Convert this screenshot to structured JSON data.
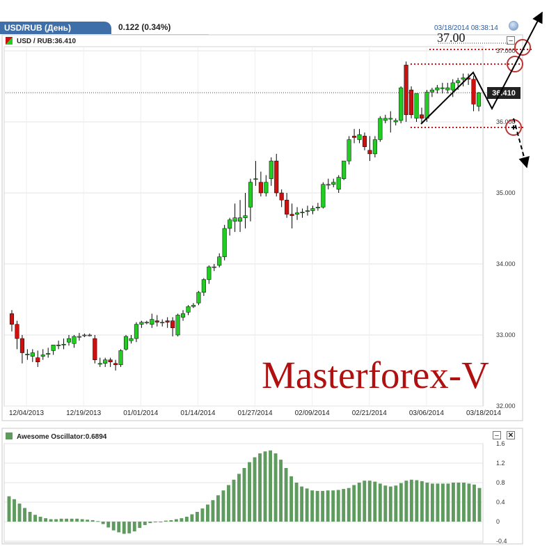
{
  "header": {
    "tab_label": "USD/RUB (День)",
    "change": "0.122 (0.34%)",
    "datetime": "03/18/2014 08:38:14"
  },
  "main_chart": {
    "symbol_label": "USD / RUB:36.410",
    "current_price_label": "36.410",
    "annotation_price": "37.00",
    "watermark_text": "Masterforex-V",
    "price_ticks": [
      "37.000",
      "36.000",
      "35.000",
      "34.000",
      "33.000",
      "32.000"
    ],
    "date_ticks": [
      "12/04/2013",
      "12/19/2013",
      "01/01/2014",
      "01/14/2014",
      "01/27/2014",
      "02/09/2014",
      "02/21/2014",
      "03/06/2014",
      "03/18/2014"
    ]
  },
  "oscillator": {
    "label": "Awesome Oscillator:0.6894",
    "ticks": [
      "1.6",
      "1.2",
      "0.8",
      "0.4",
      "0",
      "-0.4"
    ]
  },
  "colors": {
    "up_candle": "#22cc22",
    "down_candle": "#cc1111",
    "oscillator_bar": "#5f9a5f",
    "tab_bg": "#3f6fa8",
    "annotation_red": "#cc1111",
    "watermark": "#b01010"
  },
  "chart_data": [
    {
      "type": "candlestick",
      "title": "USD / RUB:36.410",
      "ylim": [
        32.0,
        37.0
      ],
      "yticks": [
        32.0,
        33.0,
        34.0,
        35.0,
        36.0,
        37.0
      ],
      "last_price": 36.41,
      "series": [
        {
          "name": "USD/RUB",
          "ohlc": [
            [
              33.3,
              33.35,
              33.05,
              33.15
            ],
            [
              33.15,
              33.2,
              32.8,
              32.95
            ],
            [
              32.95,
              33.0,
              32.6,
              32.75
            ],
            [
              32.73,
              32.8,
              32.65,
              32.73
            ],
            [
              32.7,
              32.8,
              32.62,
              32.75
            ],
            [
              32.68,
              32.78,
              32.55,
              32.62
            ],
            [
              32.7,
              32.8,
              32.65,
              32.72
            ],
            [
              32.74,
              32.82,
              32.68,
              32.74
            ],
            [
              32.78,
              32.86,
              32.72,
              32.86
            ],
            [
              32.86,
              32.92,
              32.8,
              32.86
            ],
            [
              32.86,
              32.95,
              32.8,
              32.87
            ],
            [
              32.9,
              33.0,
              32.85,
              32.95
            ],
            [
              32.88,
              33.0,
              32.82,
              32.98
            ],
            [
              32.98,
              33.03,
              32.92,
              32.98
            ],
            [
              33.0,
              33.02,
              32.97,
              33.0
            ],
            [
              33.0,
              33.02,
              32.98,
              33.0
            ],
            [
              32.95,
              33.0,
              32.6,
              32.65
            ],
            [
              32.6,
              32.68,
              32.55,
              32.6
            ],
            [
              32.6,
              32.68,
              32.55,
              32.65
            ],
            [
              32.65,
              32.68,
              32.55,
              32.62
            ],
            [
              32.6,
              32.65,
              32.5,
              32.58
            ],
            [
              32.58,
              32.8,
              32.55,
              32.78
            ],
            [
              32.8,
              33.0,
              32.78,
              32.98
            ],
            [
              32.92,
              33.0,
              32.88,
              32.95
            ],
            [
              32.95,
              33.18,
              32.9,
              33.15
            ],
            [
              33.15,
              33.2,
              33.1,
              33.18
            ],
            [
              33.18,
              33.2,
              33.15,
              33.18
            ],
            [
              33.15,
              33.3,
              33.1,
              33.22
            ],
            [
              33.2,
              33.28,
              33.12,
              33.18
            ],
            [
              33.18,
              33.22,
              33.12,
              33.18
            ],
            [
              33.2,
              33.25,
              33.1,
              33.18
            ],
            [
              33.2,
              33.25,
              32.98,
              33.1
            ],
            [
              33.0,
              33.3,
              32.98,
              33.28
            ],
            [
              33.25,
              33.35,
              33.2,
              33.3
            ],
            [
              33.32,
              33.42,
              33.28,
              33.4
            ],
            [
              33.4,
              33.45,
              33.38,
              33.42
            ],
            [
              33.45,
              33.62,
              33.42,
              33.6
            ],
            [
              33.6,
              33.8,
              33.55,
              33.78
            ],
            [
              33.78,
              33.98,
              33.72,
              33.96
            ],
            [
              33.95,
              34.0,
              33.9,
              33.96
            ],
            [
              33.98,
              34.15,
              33.95,
              34.1
            ],
            [
              34.1,
              34.55,
              34.05,
              34.5
            ],
            [
              34.5,
              34.65,
              34.4,
              34.62
            ],
            [
              34.6,
              34.85,
              34.45,
              34.65
            ],
            [
              34.6,
              34.9,
              34.45,
              34.65
            ],
            [
              34.65,
              35.0,
              34.5,
              34.68
            ],
            [
              34.8,
              35.2,
              34.6,
              35.15
            ],
            [
              35.2,
              35.45,
              35.1,
              35.2
            ],
            [
              35.15,
              35.3,
              34.95,
              35.0
            ],
            [
              35.0,
              35.25,
              34.95,
              35.15
            ],
            [
              35.2,
              35.5,
              35.1,
              35.45
            ],
            [
              35.45,
              35.55,
              34.95,
              35.0
            ],
            [
              35.0,
              35.05,
              34.8,
              34.9
            ],
            [
              34.9,
              35.0,
              34.65,
              34.7
            ],
            [
              34.7,
              34.85,
              34.5,
              34.68
            ],
            [
              34.7,
              34.8,
              34.62,
              34.72
            ],
            [
              34.72,
              34.78,
              34.65,
              34.73
            ],
            [
              34.75,
              34.82,
              34.68,
              34.75
            ],
            [
              34.75,
              34.82,
              34.7,
              34.78
            ],
            [
              34.8,
              34.86,
              34.75,
              34.8
            ],
            [
              34.8,
              35.15,
              34.78,
              35.12
            ],
            [
              35.12,
              35.2,
              35.05,
              35.12
            ],
            [
              35.12,
              35.2,
              35.08,
              35.15
            ],
            [
              35.05,
              35.25,
              35.0,
              35.22
            ],
            [
              35.2,
              35.45,
              35.18,
              35.45
            ],
            [
              35.45,
              35.8,
              35.4,
              35.75
            ],
            [
              35.8,
              35.9,
              35.7,
              35.78
            ],
            [
              35.75,
              35.9,
              35.7,
              35.82
            ],
            [
              35.8,
              35.85,
              35.6,
              35.65
            ],
            [
              35.6,
              35.8,
              35.45,
              35.55
            ],
            [
              35.55,
              35.8,
              35.5,
              35.75
            ],
            [
              35.75,
              36.08,
              35.72,
              36.05
            ],
            [
              36.02,
              36.1,
              35.98,
              36.05
            ],
            [
              36.05,
              36.15,
              35.85,
              36.05
            ],
            [
              36.0,
              36.05,
              35.95,
              36.02
            ],
            [
              36.02,
              36.5,
              35.98,
              36.48
            ],
            [
              36.8,
              36.85,
              36.0,
              36.1
            ],
            [
              36.45,
              36.5,
              36.05,
              36.1
            ],
            [
              36.05,
              36.4,
              36.0,
              36.4
            ],
            [
              36.1,
              36.2,
              35.98,
              36.05
            ],
            [
              36.05,
              36.45,
              36.0,
              36.42
            ],
            [
              36.42,
              36.48,
              36.35,
              36.45
            ],
            [
              36.45,
              36.52,
              36.4,
              36.48
            ],
            [
              36.48,
              36.55,
              36.4,
              36.48
            ],
            [
              36.45,
              36.55,
              36.4,
              36.48
            ],
            [
              36.45,
              36.6,
              36.35,
              36.55
            ],
            [
              36.55,
              36.62,
              36.45,
              36.58
            ],
            [
              36.6,
              36.68,
              36.5,
              36.62
            ],
            [
              36.62,
              36.68,
              36.52,
              36.6
            ],
            [
              36.6,
              36.65,
              36.15,
              36.25
            ],
            [
              36.22,
              36.42,
              36.15,
              36.41
            ]
          ]
        }
      ],
      "xlabels": [
        "12/04/2013",
        "12/19/2013",
        "01/01/2014",
        "01/14/2014",
        "01/27/2014",
        "02/09/2014",
        "02/21/2014",
        "03/06/2014",
        "03/18/2014"
      ]
    },
    {
      "type": "bar",
      "title": "Awesome Oscillator:0.6894",
      "ylim": [
        -0.4,
        1.6
      ],
      "yticks": [
        -0.4,
        0,
        0.4,
        0.8,
        1.2,
        1.6
      ],
      "series": [
        {
          "name": "Awesome Oscillator",
          "values": [
            0.52,
            0.46,
            0.37,
            0.28,
            0.2,
            0.14,
            0.1,
            0.07,
            0.05,
            0.05,
            0.06,
            0.06,
            0.06,
            0.06,
            0.05,
            0.04,
            0.03,
            0.01,
            -0.05,
            -0.12,
            -0.18,
            -0.22,
            -0.25,
            -0.24,
            -0.2,
            -0.13,
            -0.07,
            -0.03,
            -0.01,
            0.0,
            0.02,
            0.03,
            0.05,
            0.07,
            0.1,
            0.15,
            0.2,
            0.27,
            0.35,
            0.44,
            0.54,
            0.64,
            0.75,
            0.86,
            0.98,
            1.1,
            1.22,
            1.32,
            1.4,
            1.44,
            1.46,
            1.4,
            1.27,
            1.1,
            0.93,
            0.8,
            0.72,
            0.68,
            0.64,
            0.63,
            0.63,
            0.64,
            0.64,
            0.65,
            0.67,
            0.69,
            0.75,
            0.8,
            0.84,
            0.84,
            0.82,
            0.78,
            0.74,
            0.72,
            0.74,
            0.79,
            0.84,
            0.86,
            0.85,
            0.83,
            0.8,
            0.78,
            0.78,
            0.78,
            0.78,
            0.8,
            0.8,
            0.8,
            0.78,
            0.76,
            0.69
          ]
        }
      ]
    }
  ]
}
